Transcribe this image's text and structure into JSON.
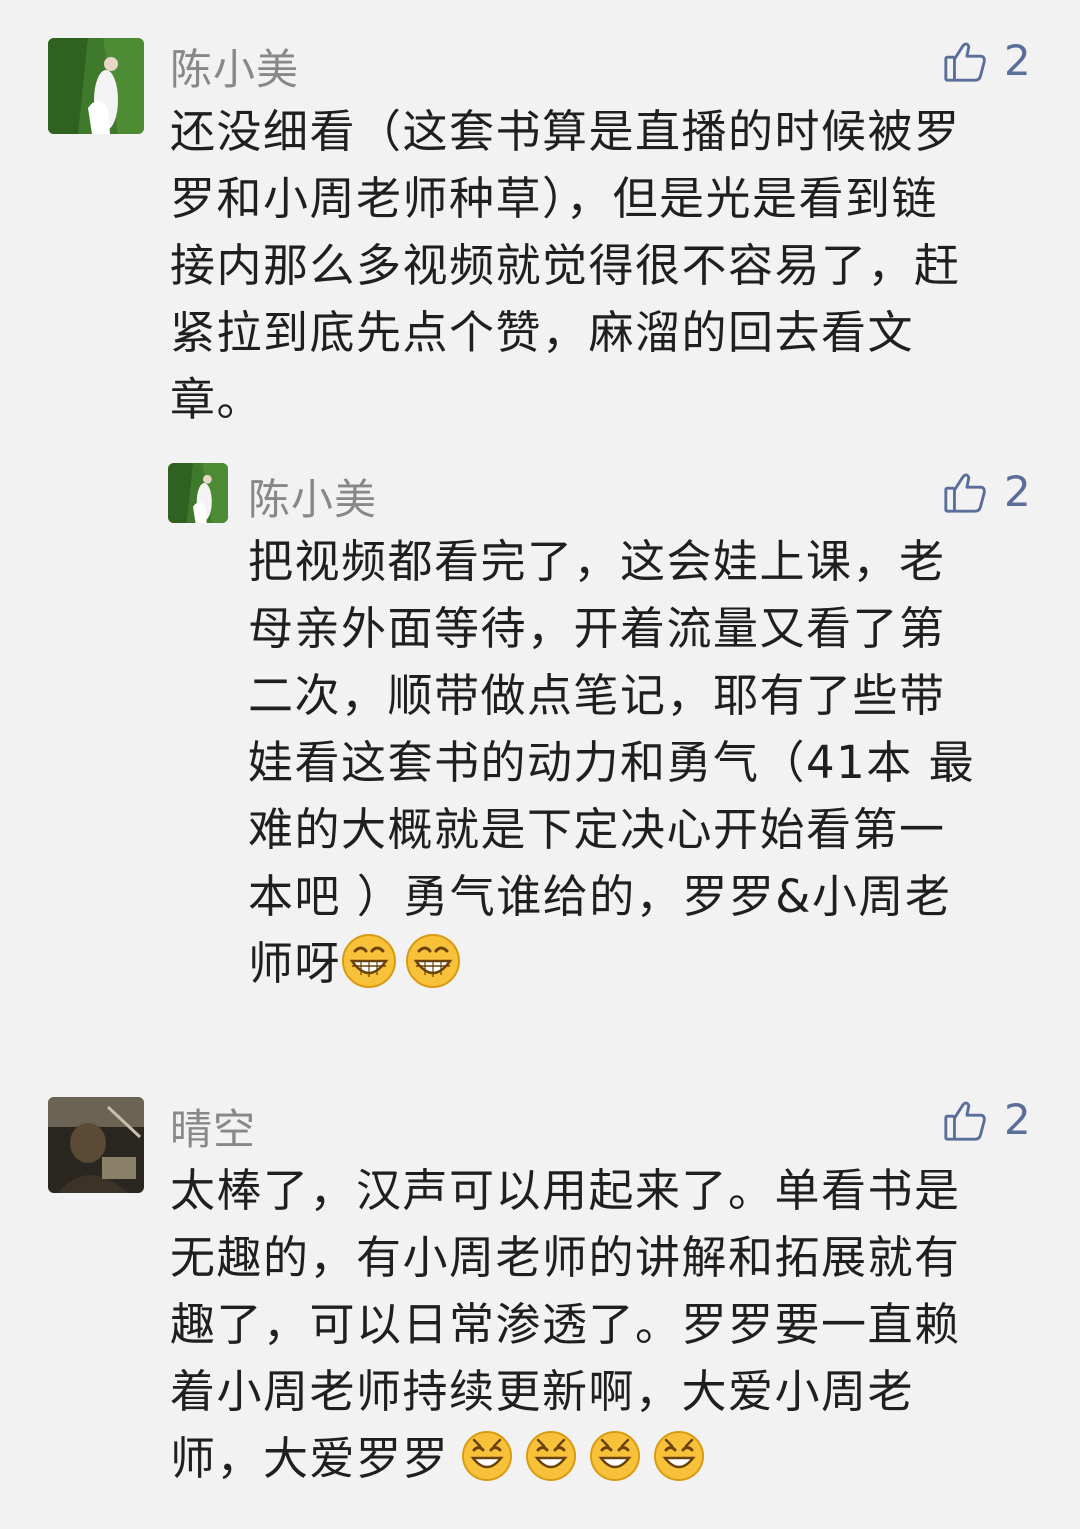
{
  "comments": [
    {
      "user_name": "陈小美",
      "like_count": "2",
      "lines": [
        "还没细看（这套书算是直播的时候被罗",
        "罗和小周老师种草），但是光是看到链",
        "接内那么多视频就觉得很不容易了，赶",
        "紧拉到底先点个赞，麻溜的回去看文",
        "章。"
      ],
      "reply": {
        "user_name": "陈小美",
        "like_count": "2",
        "lines": [
          "把视频都看完了，这会娃上课，老",
          "母亲外面等待，开着流量又看了第",
          "二次，顺带做点笔记，耶有了些带",
          "娃看这套书的动力和勇气（41本 最",
          "难的大概就是下定决心开始看第一",
          "本吧 ）勇气谁给的，罗罗&小周老"
        ],
        "last_line": "师呀"
      }
    },
    {
      "user_name": "晴空",
      "like_count": "2",
      "lines": [
        "太棒了，汉声可以用起来了。单看书是",
        "无趣的，有小周老师的讲解和拓展就有",
        "趣了，可以日常渗透了。罗罗要一直赖",
        "着小周老师持续更新啊，大爱小周老"
      ],
      "last_line": "师，大爱罗罗"
    }
  ],
  "icons": {
    "like": "thumbs-up-outline-icon",
    "grin_emoji": "grin-emoji-icon",
    "smile_emoji": "smile-emoji-icon"
  },
  "colors": {
    "background": "#f2f2f2",
    "name": "#888888",
    "like": "#5a6e9a",
    "text": "#1f1f1f"
  }
}
